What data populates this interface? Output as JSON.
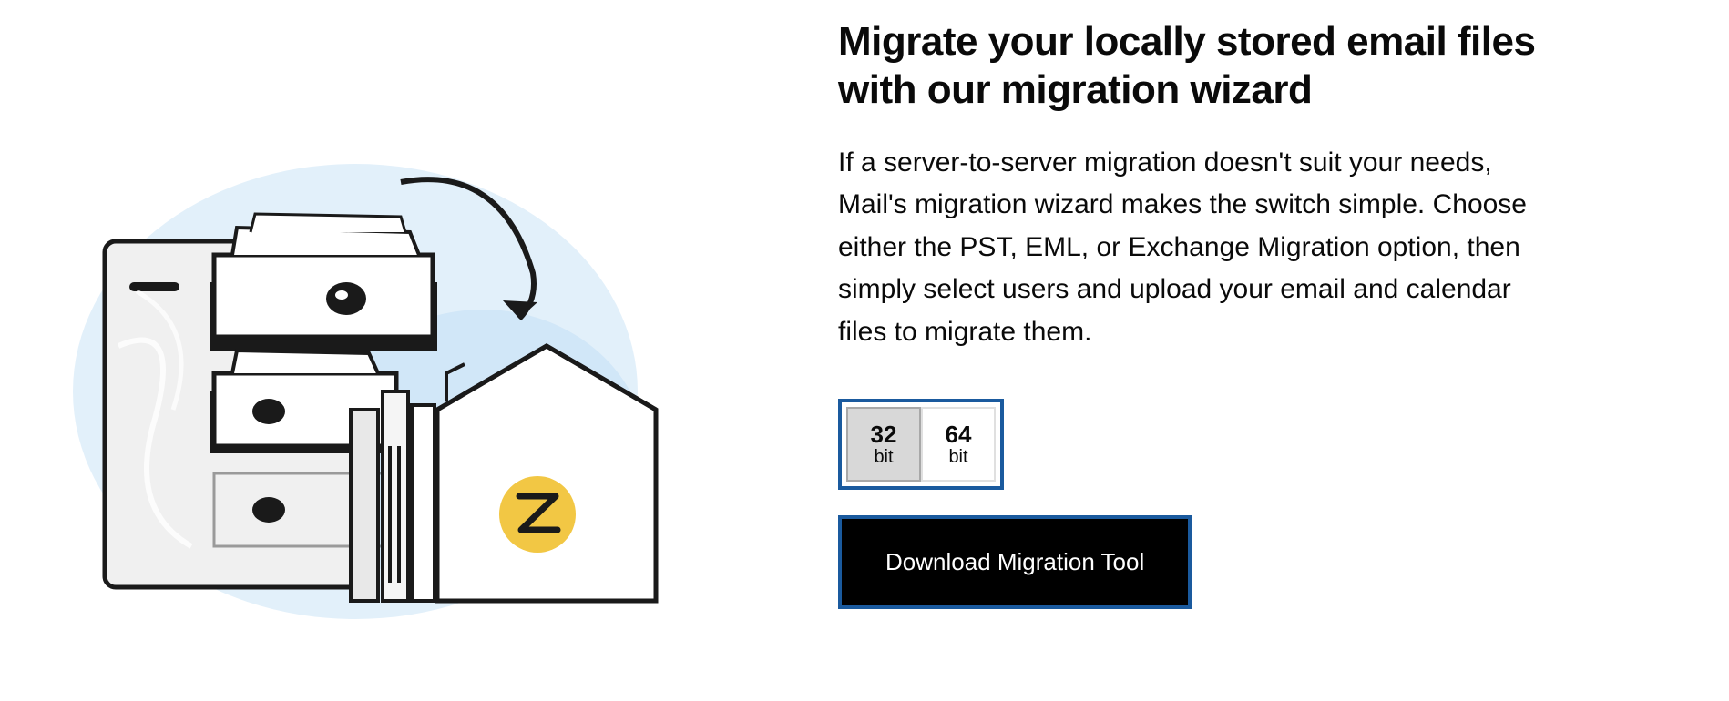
{
  "heading": "Migrate your locally stored email files with our migration wizard",
  "body": "If a server-to-server migration doesn't suit your needs, Mail's migration wizard makes the switch simple. Choose either the PST, EML, or Exchange Migration option, then simply select users and upload your email and calendar files to migrate them.",
  "bitSelector": {
    "options": [
      {
        "number": "32",
        "label": "bit",
        "selected": true
      },
      {
        "number": "64",
        "label": "bit",
        "selected": false
      }
    ]
  },
  "downloadButton": "Download Migration Tool",
  "colors": {
    "highlight": "#1a5a9e",
    "buttonBg": "#000000",
    "selectedBg": "#d8d8d8"
  }
}
